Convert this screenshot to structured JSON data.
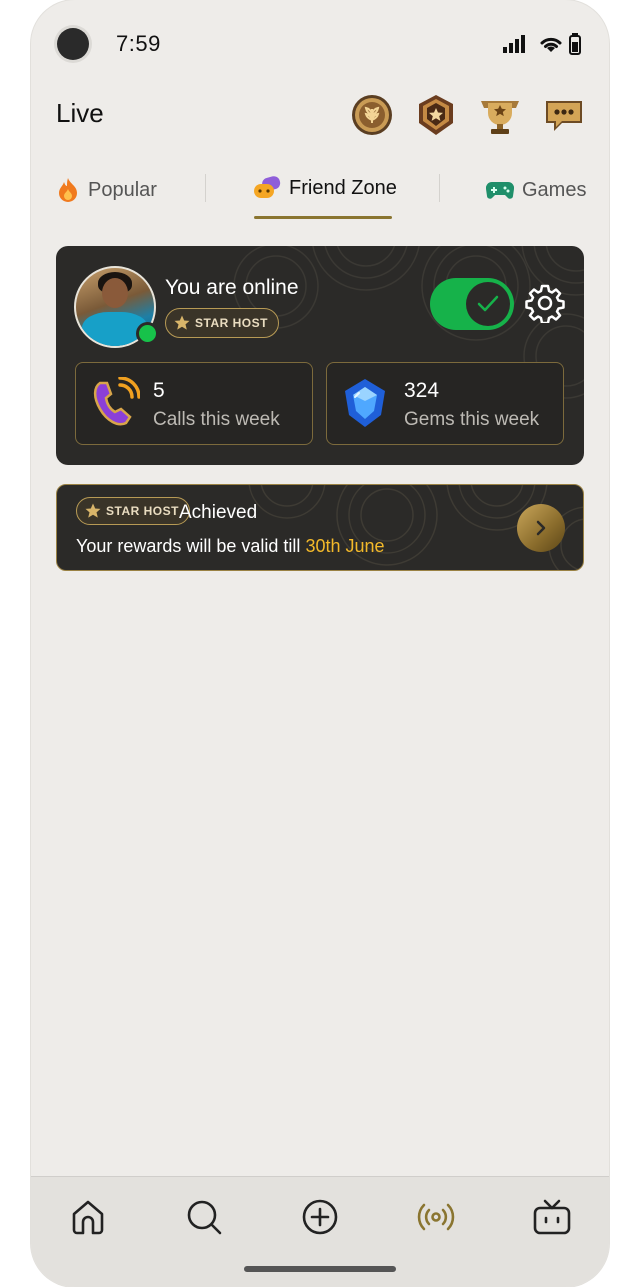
{
  "status": {
    "time": "7:59"
  },
  "header": {
    "title": "Live",
    "icons": [
      "wheat-medal-icon",
      "star-shield-icon",
      "trophy-icon",
      "chat-badge-icon"
    ]
  },
  "tabs": [
    {
      "label": "Popular",
      "icon": "flame-icon",
      "active": false
    },
    {
      "label": "Friend Zone",
      "icon": "gamepad-duo-icon",
      "active": true
    },
    {
      "label": "Games",
      "icon": "gamepad-icon",
      "active": false
    }
  ],
  "online_card": {
    "status_text": "You are online",
    "badge_label": "STAR HOST",
    "toggle_on": true,
    "stats": [
      {
        "value": "5",
        "label": "Calls this week",
        "icon": "phone-call-icon"
      },
      {
        "value": "324",
        "label": "Gems this week",
        "icon": "gem-icon"
      }
    ]
  },
  "achievement": {
    "badge_label": "STAR HOST",
    "title": "Achieved",
    "text": "Your rewards will be valid till ",
    "date": "30th June"
  },
  "bottom_nav": [
    {
      "name": "home",
      "icon": "home-icon",
      "active": false
    },
    {
      "name": "search",
      "icon": "search-icon",
      "active": false
    },
    {
      "name": "create",
      "icon": "plus-circle-icon",
      "active": false
    },
    {
      "name": "live",
      "icon": "broadcast-icon",
      "active": true
    },
    {
      "name": "tv",
      "icon": "tv-icon",
      "active": false
    }
  ],
  "colors": {
    "background": "#eeece9",
    "card": "#2b2a28",
    "accent_gold": "#8a7530",
    "toggle_green": "#16b24a",
    "date_highlight": "#f3b92a"
  }
}
